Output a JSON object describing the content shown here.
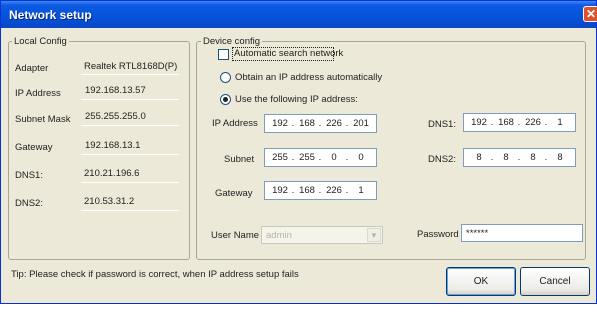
{
  "window": {
    "title": "Network setup"
  },
  "local_config": {
    "title": "Local Config",
    "rows": [
      {
        "label": "Adapter",
        "value": "Realtek RTL8168D(P)"
      },
      {
        "label": "IP Address",
        "value": "192.168.13.57"
      },
      {
        "label": "Subnet Mask",
        "value": "255.255.255.0"
      },
      {
        "label": "Gateway",
        "value": "192.168.13.1"
      },
      {
        "label": "DNS1:",
        "value": "210.21.196.6"
      },
      {
        "label": "DNS2:",
        "value": "210.53.31.2"
      }
    ]
  },
  "device_config": {
    "title": "Device config",
    "auto_search": {
      "label": "Automatic search network",
      "checked": false
    },
    "radio_auto": {
      "label": "Obtain an IP address automatically",
      "selected": false
    },
    "radio_manual": {
      "label": "Use the following IP address:",
      "selected": true
    },
    "ip_address": {
      "label": "IP Address",
      "octets": [
        "192",
        "168",
        "226",
        "201"
      ]
    },
    "subnet": {
      "label": "Subnet",
      "octets": [
        "255",
        "255",
        "0",
        "0"
      ]
    },
    "gateway": {
      "label": "Gateway",
      "octets": [
        "192",
        "168",
        "226",
        "1"
      ]
    },
    "dns1": {
      "label": "DNS1:",
      "octets": [
        "192",
        "168",
        "226",
        "1"
      ]
    },
    "dns2": {
      "label": "DNS2:",
      "octets": [
        "8",
        "8",
        "8",
        "8"
      ]
    }
  },
  "credentials": {
    "username_label": "User Name",
    "username_value": "admin",
    "password_label": "Password",
    "password_value": "******"
  },
  "tip": "Tip: Please check if password is correct, when IP address setup fails",
  "buttons": {
    "ok": "OK",
    "cancel": "Cancel"
  },
  "icons": {
    "close": "close-icon",
    "dropdown": "chevron-down-icon"
  },
  "colors": {
    "title_bar": "#0453db",
    "dialog_bg": "#ece9d8",
    "close": "#e0502c"
  }
}
